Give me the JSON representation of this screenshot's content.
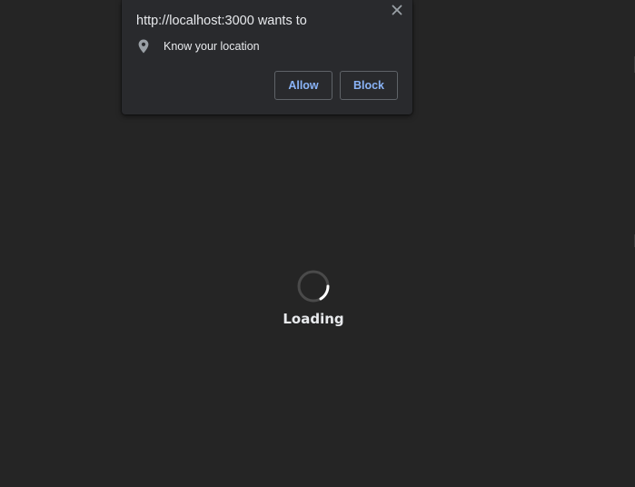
{
  "permission_popup": {
    "title": "http://localhost:3000 wants to",
    "permission": {
      "icon": "location-pin-icon",
      "label": "Know your location"
    },
    "close_icon": "close-icon",
    "allow_label": "Allow",
    "block_label": "Block"
  },
  "loader": {
    "spinner_icon": "spinner-icon",
    "label": "Loading"
  },
  "colors": {
    "background": "#252525",
    "popup_background": "#292a2d",
    "text": "#e8eaed",
    "button_text": "#8ab4f8",
    "button_border": "#5f6368"
  }
}
